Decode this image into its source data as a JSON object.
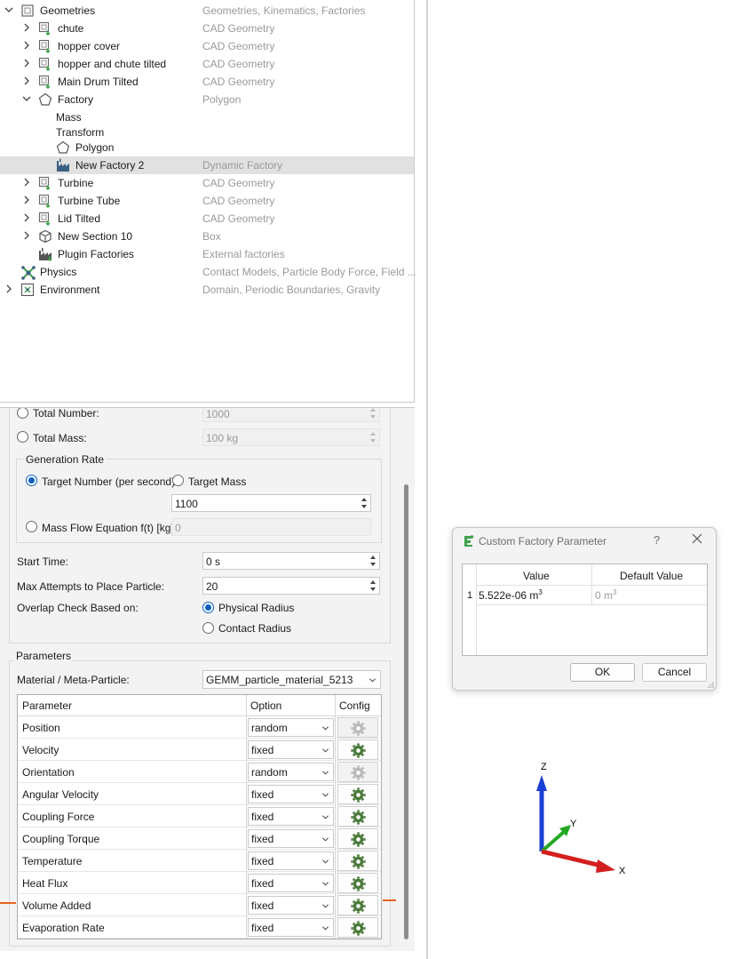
{
  "tree": {
    "items": [
      {
        "label": "Geometries",
        "desc": "Geometries, Kinematics, Factories",
        "level": 0,
        "expanded": true,
        "icon": "geometry-folder-icon"
      },
      {
        "label": "chute",
        "desc": "CAD Geometry",
        "level": 1,
        "expanded": false,
        "icon": "cad-geometry-icon"
      },
      {
        "label": "hopper cover",
        "desc": "CAD Geometry",
        "level": 1,
        "expanded": false,
        "icon": "cad-geometry-icon"
      },
      {
        "label": "hopper and chute tilted",
        "desc": "CAD Geometry",
        "level": 1,
        "expanded": false,
        "icon": "cad-geometry-icon"
      },
      {
        "label": "Main Drum Tilted",
        "desc": "CAD Geometry",
        "level": 1,
        "expanded": false,
        "icon": "cad-geometry-icon"
      },
      {
        "label": "Factory",
        "desc": "Polygon",
        "level": 1,
        "expanded": true,
        "icon": "polygon-icon"
      },
      {
        "label": "Mass",
        "desc": "",
        "level": 2,
        "icon": "none"
      },
      {
        "label": "Transform",
        "desc": "",
        "level": 2,
        "icon": "none"
      },
      {
        "label": "Polygon",
        "desc": "",
        "level": 2,
        "icon": "polygon-icon"
      },
      {
        "label": "New Factory 2",
        "desc": "Dynamic Factory",
        "level": 2,
        "selected": true,
        "icon": "factory-icon"
      },
      {
        "label": "Turbine",
        "desc": "CAD Geometry",
        "level": 1,
        "expanded": false,
        "icon": "cad-geometry-icon"
      },
      {
        "label": "Turbine Tube",
        "desc": "CAD Geometry",
        "level": 1,
        "expanded": false,
        "icon": "cad-geometry-icon"
      },
      {
        "label": "Lid Tilted",
        "desc": "CAD Geometry",
        "level": 1,
        "expanded": false,
        "icon": "cad-geometry-icon"
      },
      {
        "label": "New Section 10",
        "desc": "Box",
        "level": 1,
        "expanded": false,
        "icon": "box-icon"
      },
      {
        "label": "Plugin Factories",
        "desc": "External factories",
        "level": 1,
        "icon": "plugin-factory-icon"
      },
      {
        "label": "Physics",
        "desc": "Contact Models, Particle Body Force, Field ...",
        "level": 0,
        "icon": "physics-icon"
      },
      {
        "label": "Environment",
        "desc": "Domain, Periodic Boundaries, Gravity",
        "level": 0,
        "expanded": false,
        "icon": "environment-icon"
      }
    ]
  },
  "settings": {
    "total_number_label": "Total Number:",
    "total_number_value": "1000",
    "total_mass_label": "Total Mass:",
    "total_mass_value": "100 kg",
    "generation_rate_title": "Generation Rate",
    "target_number_label": "Target Number (per second)",
    "target_mass_label": "Target Mass",
    "rate_value": "1100",
    "mass_flow_label": "Mass Flow Equation f(t) [kg]",
    "mass_flow_value": "0",
    "start_time_label": "Start Time:",
    "start_time_value": "0 s",
    "max_attempts_label": "Max Attempts to Place Particle:",
    "max_attempts_value": "20",
    "overlap_label": "Overlap Check Based on:",
    "physical_radius_label": "Physical Radius",
    "contact_radius_label": "Contact Radius"
  },
  "parameters": {
    "group_title": "Parameters",
    "material_label": "Material / Meta-Particle:",
    "material_value": "GEMM_particle_material_5213",
    "columns": [
      "Parameter",
      "Option",
      "Config"
    ],
    "rows": [
      {
        "name": "Position",
        "option": "random",
        "config_enabled": false
      },
      {
        "name": "Velocity",
        "option": "fixed",
        "config_enabled": true
      },
      {
        "name": "Orientation",
        "option": "random",
        "config_enabled": false
      },
      {
        "name": "Angular Velocity",
        "option": "fixed",
        "config_enabled": true
      },
      {
        "name": "Coupling Force",
        "option": "fixed",
        "config_enabled": true
      },
      {
        "name": "Coupling Torque",
        "option": "fixed",
        "config_enabled": true
      },
      {
        "name": "Temperature",
        "option": "fixed",
        "config_enabled": true
      },
      {
        "name": "Heat Flux",
        "option": "fixed",
        "config_enabled": true
      },
      {
        "name": "Volume Added",
        "option": "fixed",
        "config_enabled": true
      },
      {
        "name": "Evaporation Rate",
        "option": "fixed",
        "config_enabled": true
      }
    ]
  },
  "dialog": {
    "title": "Custom Factory Parameter",
    "help": "?",
    "columns": [
      "Value",
      "Default Value"
    ],
    "row_number": "1",
    "value_main": "5.522e-06 m",
    "value_exp": "3",
    "default_main": "0 m",
    "default_exp": "3",
    "ok_label": "OK",
    "cancel_label": "Cancel"
  },
  "axis": {
    "x": "X",
    "y": "Y",
    "z": "Z",
    "x_color": "#d41f1f",
    "y_color": "#22a822",
    "z_color": "#1a3fd4"
  },
  "colors": {
    "accent": "#0a5fc2",
    "gear": "#4a7a3a",
    "marker": "#e8641e"
  }
}
